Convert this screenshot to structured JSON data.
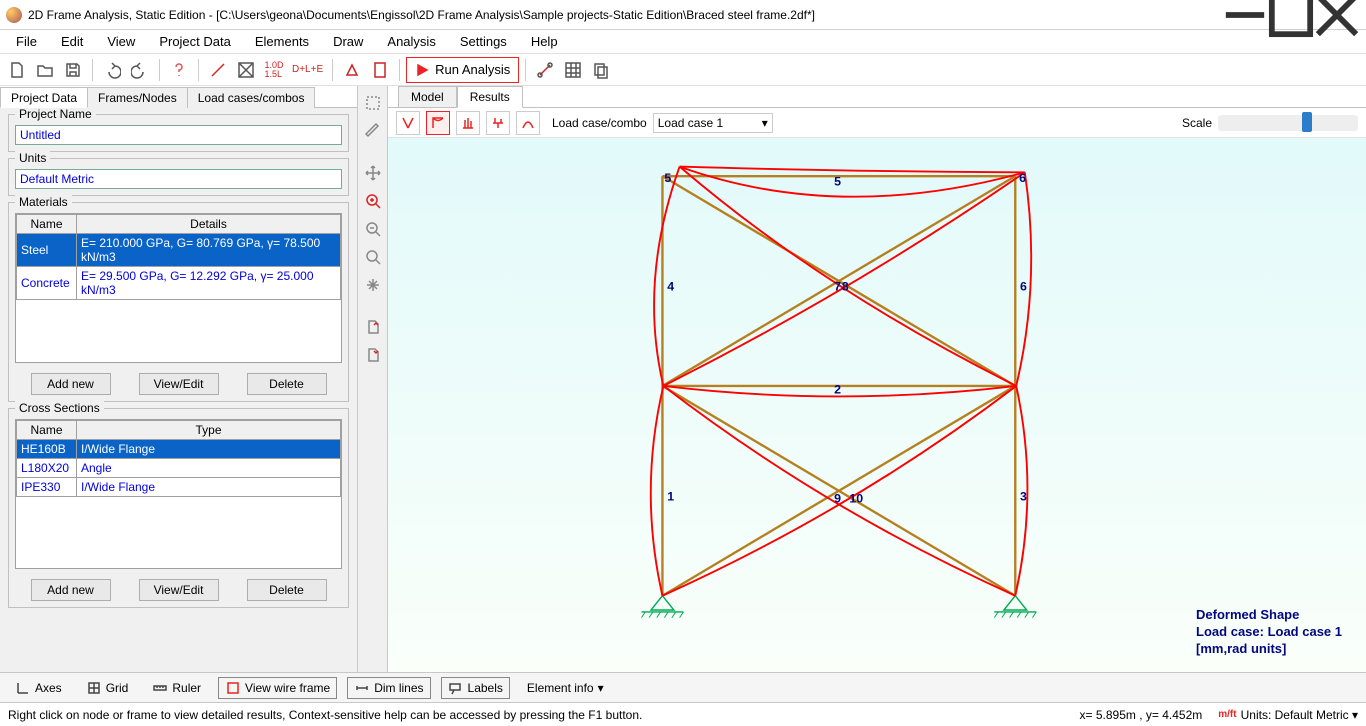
{
  "window": {
    "title": "2D Frame Analysis, Static Edition - [C:\\Users\\geona\\Documents\\Engissol\\2D Frame Analysis\\Sample projects-Static Edition\\Braced steel frame.2df*]"
  },
  "menubar": [
    "File",
    "Edit",
    "View",
    "Project Data",
    "Elements",
    "Draw",
    "Analysis",
    "Settings",
    "Help"
  ],
  "toolbar": {
    "run": "Run Analysis"
  },
  "leftTabs": [
    "Project Data",
    "Frames/Nodes",
    "Load cases/combos"
  ],
  "project": {
    "nameLegend": "Project Name",
    "name": "Untitled",
    "unitsLegend": "Units",
    "units": "Default Metric"
  },
  "materials": {
    "legend": "Materials",
    "cols": {
      "name": "Name",
      "details": "Details"
    },
    "rows": [
      {
        "name": "Steel",
        "details": "E= 210.000 GPa, G= 80.769 GPa, γ= 78.500 kN/m3"
      },
      {
        "name": "Concrete",
        "details": "E= 29.500 GPa, G= 12.292 GPa, γ= 25.000 kN/m3"
      }
    ],
    "buttons": {
      "add": "Add new",
      "edit": "View/Edit",
      "del": "Delete"
    }
  },
  "sections": {
    "legend": "Cross Sections",
    "cols": {
      "name": "Name",
      "type": "Type"
    },
    "rows": [
      {
        "name": "HE160B",
        "type": "I/Wide Flange"
      },
      {
        "name": "L180X20",
        "type": "Angle"
      },
      {
        "name": "IPE330",
        "type": "I/Wide Flange"
      }
    ],
    "buttons": {
      "add": "Add new",
      "edit": "View/Edit",
      "del": "Delete"
    }
  },
  "canvasTabs": [
    "Model",
    "Results"
  ],
  "ctoolbar": {
    "lcLabel": "Load case/combo",
    "lcValue": "Load case 1",
    "scaleLabel": "Scale"
  },
  "members": {
    "m1": "1",
    "m2": "2",
    "m3": "3",
    "m4": "4",
    "m5": "5",
    "m6": "6",
    "m7": "7",
    "m8": "8",
    "m9": "9",
    "m10": "10",
    "n5": "5",
    "n6": "6"
  },
  "defShape": {
    "l1": "Deformed Shape",
    "l2": "Load case: Load case 1",
    "l3": "[mm,rad units]"
  },
  "bottombar": {
    "axes": "Axes",
    "grid": "Grid",
    "ruler": "Ruler",
    "wire": "View wire frame",
    "dim": "Dim lines",
    "labels": "Labels",
    "info": "Element info"
  },
  "statusbar": {
    "hint": "Right click on node or frame to view detailed results, Context-sensitive help can be accessed by pressing the F1 button.",
    "coord": "x= 5.895m , y= 4.452m",
    "unitsPrefix": "m/ft",
    "unitsLabel": "Units: Default Metric"
  }
}
